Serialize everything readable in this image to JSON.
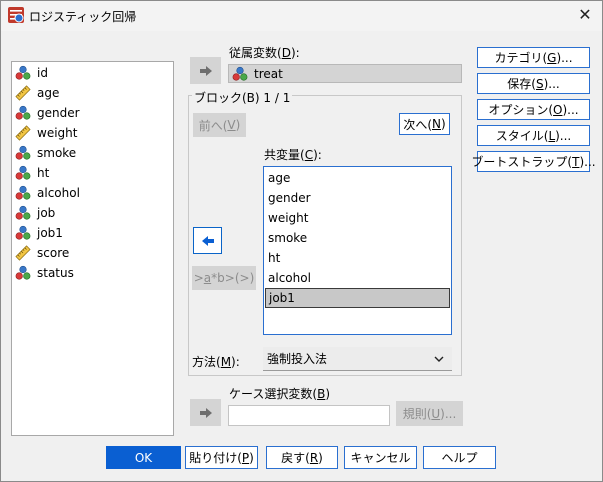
{
  "window": {
    "title": "ロジスティック回帰",
    "close_glyph": "✕"
  },
  "variables": [
    {
      "name": "id",
      "type": "nominal"
    },
    {
      "name": "age",
      "type": "scale"
    },
    {
      "name": "gender",
      "type": "nominal"
    },
    {
      "name": "weight",
      "type": "scale"
    },
    {
      "name": "smoke",
      "type": "nominal"
    },
    {
      "name": "ht",
      "type": "nominal"
    },
    {
      "name": "alcohol",
      "type": "nominal"
    },
    {
      "name": "job",
      "type": "nominal"
    },
    {
      "name": "job1",
      "type": "nominal"
    },
    {
      "name": "score",
      "type": "scale"
    },
    {
      "name": "status",
      "type": "nominal"
    }
  ],
  "dependent": {
    "label_pre": "従属変数(",
    "label_key": "D",
    "label_post": "):",
    "value": "treat"
  },
  "block": {
    "label": "ブロック(B) 1 / 1",
    "prev_pre": "前へ(",
    "prev_key": "V",
    "prev_post": ")",
    "next_pre": "次へ(",
    "next_key": "N",
    "next_post": ")"
  },
  "covariates": {
    "label_pre": "共変量(",
    "label_key": "C",
    "label_post": "):",
    "items": [
      "age",
      "gender",
      "weight",
      "smoke",
      "ht",
      "alcohol",
      "job1"
    ],
    "selected_index": 6
  },
  "interaction_button": {
    "pre": ">",
    "key": "a",
    "post": "*b>(>)"
  },
  "method": {
    "label_pre": "方法(",
    "label_key": "M",
    "label_post": "):",
    "value": "強制投入法"
  },
  "case_selection": {
    "label_pre": "ケース選択変数(",
    "label_key": "B",
    "label_post": ")",
    "value": ""
  },
  "rule_button": {
    "pre": "規則(",
    "key": "U",
    "post": ")..."
  },
  "side_buttons": [
    {
      "pre": "カテゴリ(",
      "key": "G",
      "post": ")..."
    },
    {
      "pre": "保存(",
      "key": "S",
      "post": ")..."
    },
    {
      "pre": "オプション(",
      "key": "O",
      "post": ")..."
    },
    {
      "pre": "スタイル(",
      "key": "L",
      "post": ")..."
    },
    {
      "pre": "ブートストラップ(",
      "key": "T",
      "post": ")..."
    }
  ],
  "bottom_buttons": {
    "ok": "OK",
    "paste": {
      "pre": "貼り付け(",
      "key": "P",
      "post": ")"
    },
    "reset": {
      "pre": "戻す(",
      "key": "R",
      "post": ")"
    },
    "cancel": "キャンセル",
    "help": "ヘルプ"
  },
  "colors": {
    "accent": "#0a5fd2",
    "selection": "#c8c8c8",
    "disabled_button": "#d4d4d4"
  },
  "icons": {
    "nominal": "nominal-variable-icon",
    "scale": "scale-ruler-icon",
    "arrow_right": "arrow-right-icon",
    "arrow_left": "arrow-left-icon",
    "chevron": "chevron-down-icon"
  }
}
